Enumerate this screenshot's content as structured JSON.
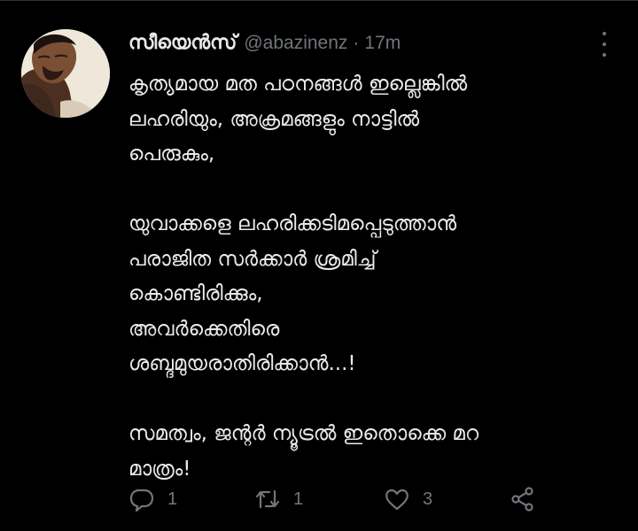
{
  "tweet": {
    "author": {
      "display_name": "സീയെൻസ്",
      "handle": "@abazinenz",
      "separator": "·",
      "time": "17m"
    },
    "body_lines": [
      "കൃത്യമായ മത പഠനങ്ങൾ ഇല്ലെങ്കിൽ",
      "ലഹരിയും, അക്രമങ്ങളും നാട്ടിൽ",
      "പെരുകും,",
      "",
      "യുവാക്കളെ ലഹരിക്കടിമപ്പെടുത്താൻ",
      "പരാജിത സർക്കാർ ശ്രമിച്ച്",
      "കൊണ്ടിരിക്കും,",
      "അവർക്കെതിരെ",
      "ശബ്ദമുയരാതിരിക്കാൻ...!",
      "",
      "സമത്വം, ജന്റർ ന്യൂട്രൽ ഇതൊക്കെ മറ",
      "മാത്രം!"
    ],
    "actions": {
      "reply": {
        "icon": "reply-icon",
        "count": "1"
      },
      "retweet": {
        "icon": "retweet-icon",
        "count": "1"
      },
      "like": {
        "icon": "heart-icon",
        "count": "3"
      },
      "share": {
        "icon": "share-icon"
      }
    }
  },
  "colors": {
    "background": "#000000",
    "primary_text": "#e7e9ea",
    "secondary_text": "#71767b",
    "divider": "#2f3336"
  }
}
